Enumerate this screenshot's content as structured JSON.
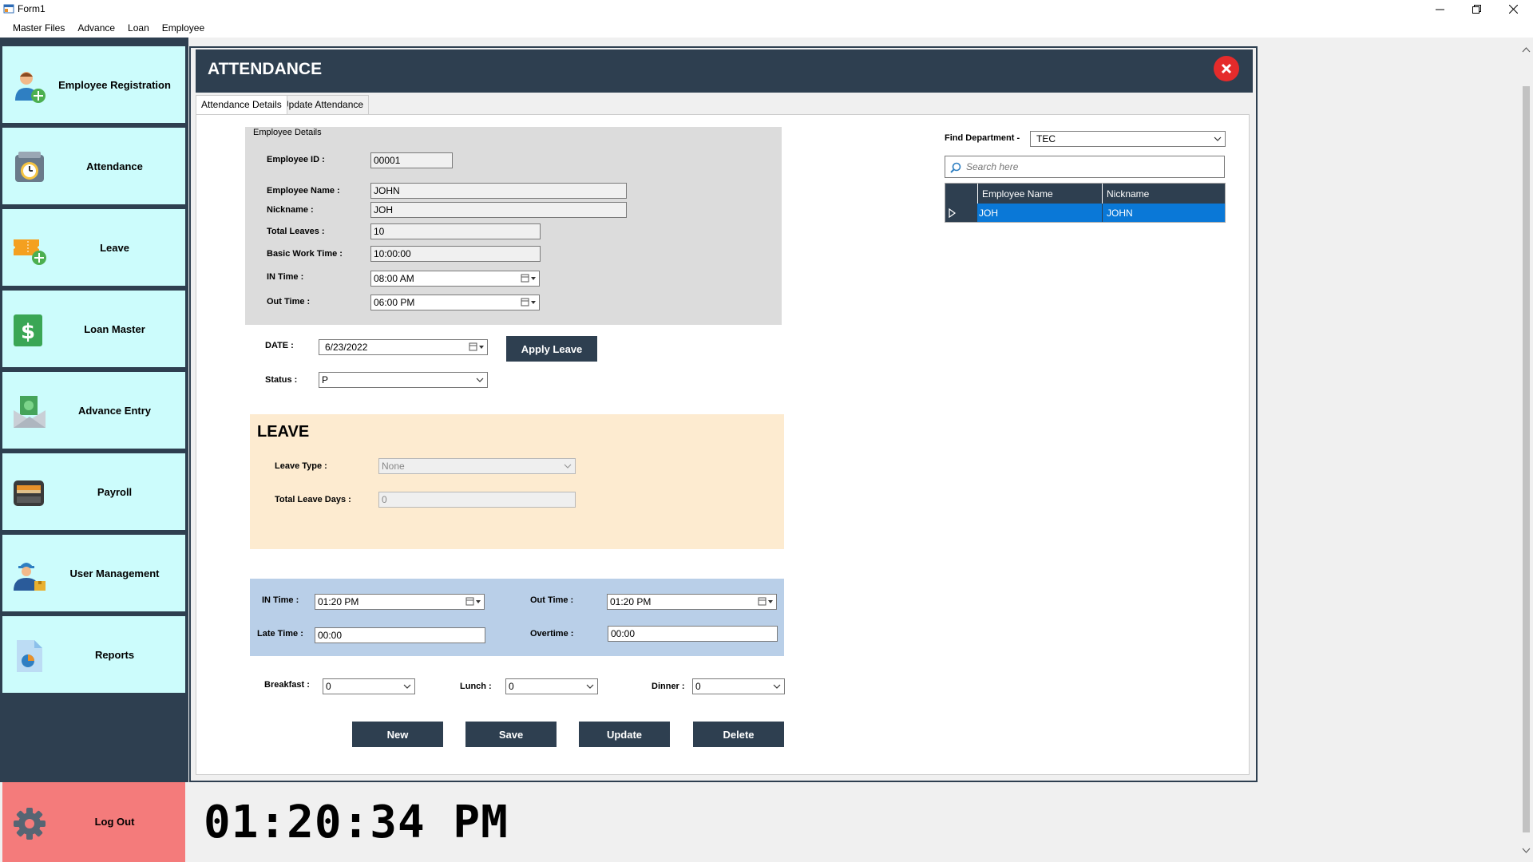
{
  "window": {
    "title": "Form1",
    "minimize_icon": "minimize-icon",
    "restore_icon": "restore-icon",
    "close_icon": "close-icon"
  },
  "menu": [
    "Master Files",
    "Advance",
    "Loan",
    "Employee"
  ],
  "sidebar": {
    "items": [
      {
        "label": "Employee Registration",
        "icon": "user-add-icon"
      },
      {
        "label": "Attendance",
        "icon": "clock-icon"
      },
      {
        "label": "Leave",
        "icon": "ticket-add-icon"
      },
      {
        "label": "Loan Master",
        "icon": "dollar-icon"
      },
      {
        "label": "Advance Entry",
        "icon": "money-envelope-icon"
      },
      {
        "label": "Payroll",
        "icon": "wallet-icon"
      },
      {
        "label": "User Management",
        "icon": "worker-icon"
      },
      {
        "label": "Reports",
        "icon": "report-chart-icon"
      }
    ],
    "logout": {
      "label": "Log Out",
      "icon": "gear-icon"
    }
  },
  "header": {
    "title": "ATTENDANCE"
  },
  "tabs": [
    {
      "label": "Attendance Details",
      "active": true
    },
    {
      "label": "Update Attendance",
      "active": false
    }
  ],
  "employee_details": {
    "group_title": "Employee Details",
    "employee_id_label": "Employee ID :",
    "employee_id": "00001",
    "employee_name_label": "Employee Name :",
    "employee_name": "JOHN",
    "nickname_label": "Nickname :",
    "nickname": "JOH",
    "total_leaves_label": "Total Leaves :",
    "total_leaves": "10",
    "basic_work_time_label": "Basic Work Time :",
    "basic_work_time": "10:00:00",
    "in_time_label": "IN Time :",
    "in_time": "08:00 AM",
    "out_time_label": "Out Time :",
    "out_time": "06:00 PM"
  },
  "date_section": {
    "date_label": "DATE :",
    "date": "6/23/2022",
    "apply_leave": "Apply Leave",
    "status_label": "Status :",
    "status": "P"
  },
  "leave": {
    "title": "LEAVE",
    "leave_type_label": "Leave Type :",
    "leave_type": "None",
    "total_leave_days_label": "Total Leave Days :",
    "total_leave_days": "0"
  },
  "time_panel": {
    "in_time_label": "IN Time :",
    "in_time": "01:20 PM",
    "out_time_label": "Out Time :",
    "out_time": "01:20 PM",
    "late_time_label": "Late Time :",
    "late_time": "00:00",
    "overtime_label": "Overtime :",
    "overtime": "00:00"
  },
  "meals": {
    "breakfast_label": "Breakfast :",
    "breakfast": "0",
    "lunch_label": "Lunch :",
    "lunch": "0",
    "dinner_label": "Dinner :",
    "dinner": "0"
  },
  "actions": {
    "new": "New",
    "save": "Save",
    "update": "Update",
    "delete": "Delete"
  },
  "find": {
    "department_label": "Find Department -",
    "department": "TEC",
    "search_placeholder": "Search here"
  },
  "grid": {
    "columns": [
      "Employee Name",
      "Nickname"
    ],
    "rows": [
      [
        "JOH",
        "JOHN"
      ]
    ]
  },
  "clock": {
    "time": "01:20:34 PM"
  },
  "colors": {
    "sidebar_bg": "#2e3f50",
    "sidebar_button": "#ccfcfc",
    "logout_button": "#f47b7b",
    "header_bg": "#2e3f50",
    "leave_panel": "#fdebd0",
    "time_panel": "#b9cfe8",
    "selected_row": "#0a78d7",
    "close_button": "#e52b2b"
  }
}
